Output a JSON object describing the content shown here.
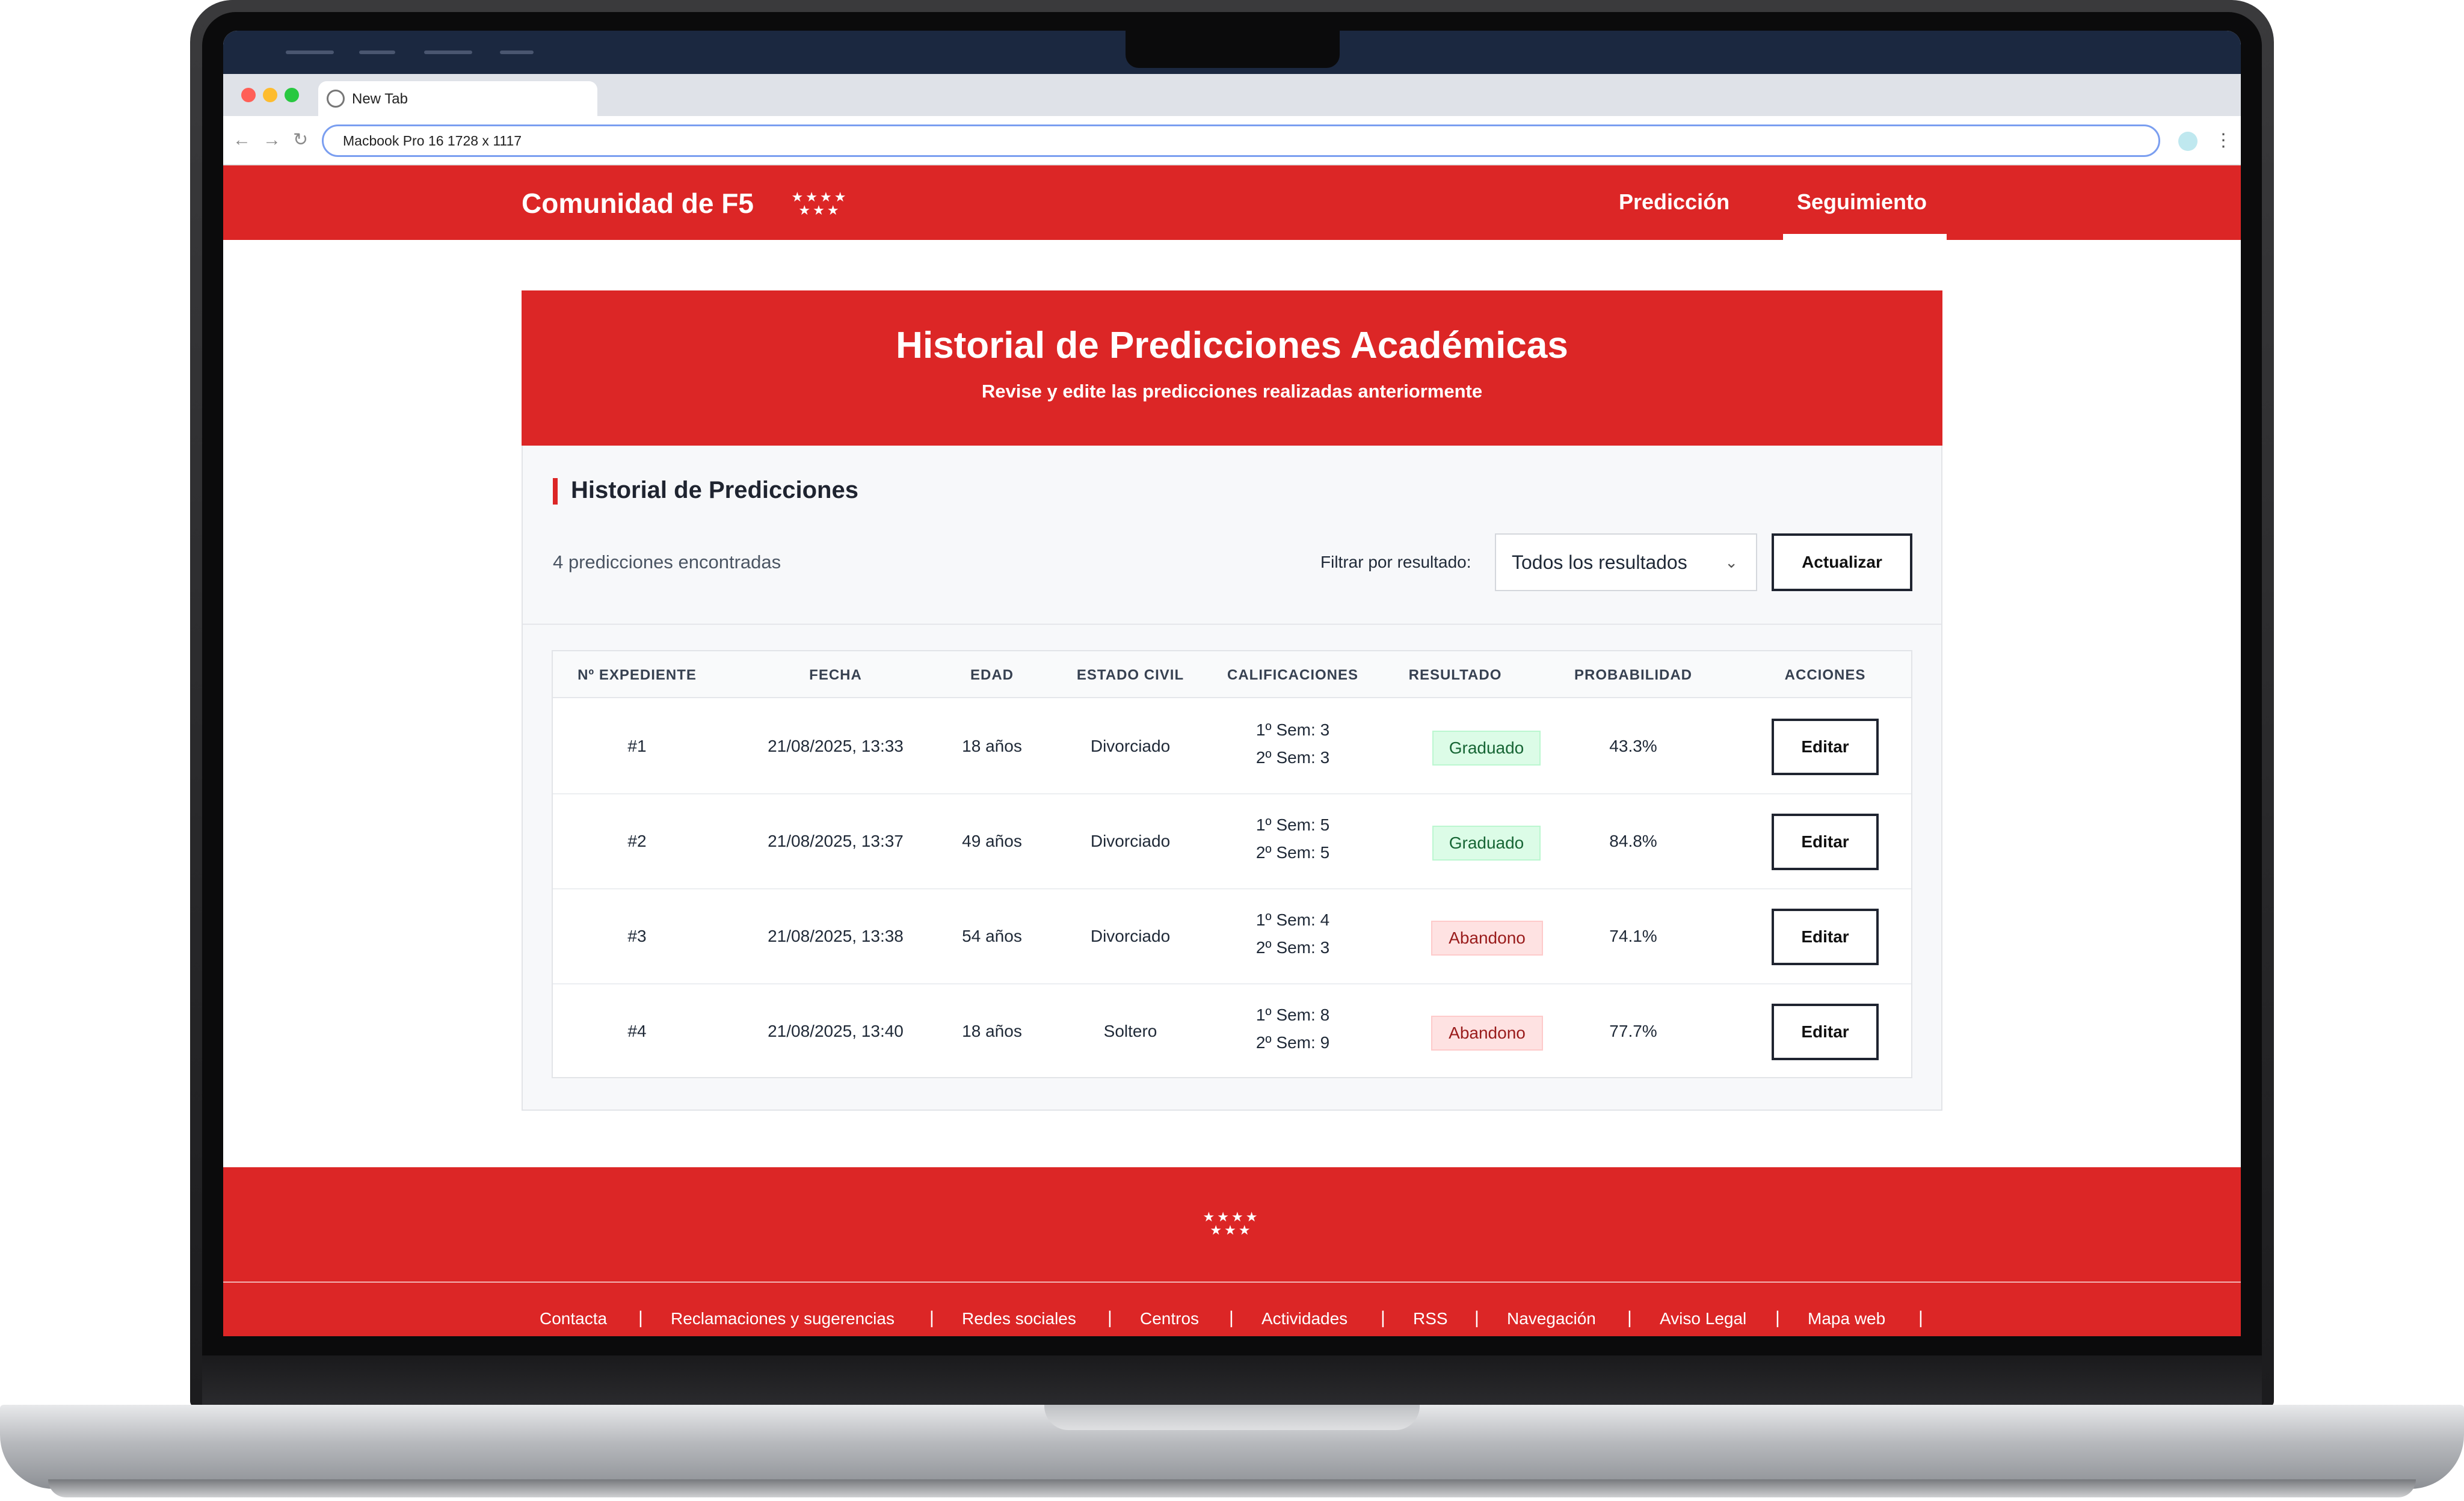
{
  "browser": {
    "tab_title": "New Tab",
    "address": "Macbook Pro 16  1728 x 1117"
  },
  "site": {
    "brand": "Comunidad de F5",
    "nav": [
      {
        "label": "Predicción",
        "active": false
      },
      {
        "label": "Seguimiento",
        "active": true
      }
    ]
  },
  "hero": {
    "title": "Historial de Predicciones Académicas",
    "subtitle": "Revise y edite las predicciones realizadas anteriormente"
  },
  "history": {
    "section_title": "Historial de Predicciones",
    "count_text": "4 predicciones encontradas",
    "filter_label": "Filtrar por resultado:",
    "filter_value": "Todos los resultados",
    "refresh_label": "Actualizar",
    "columns": [
      "Nº EXPEDIENTE",
      "FECHA",
      "EDAD",
      "ESTADO CIVIL",
      "CALIFICACIONES",
      "RESULTADO",
      "PROBABILIDAD",
      "ACCIONES"
    ],
    "rows": [
      {
        "id": "#1",
        "date": "21/08/2025, 13:33",
        "age": "18 años",
        "civil": "Divorciado",
        "sem1": "1º Sem: 3",
        "sem2": "2º Sem: 3",
        "result": "Graduado",
        "result_type": "ok",
        "probability": "43.3%",
        "action": "Editar"
      },
      {
        "id": "#2",
        "date": "21/08/2025, 13:37",
        "age": "49 años",
        "civil": "Divorciado",
        "sem1": "1º Sem: 5",
        "sem2": "2º Sem: 5",
        "result": "Graduado",
        "result_type": "ok",
        "probability": "84.8%",
        "action": "Editar"
      },
      {
        "id": "#3",
        "date": "21/08/2025, 13:38",
        "age": "54 años",
        "civil": "Divorciado",
        "sem1": "1º Sem: 4",
        "sem2": "2º Sem: 3",
        "result": "Abandono",
        "result_type": "bad",
        "probability": "74.1%",
        "action": "Editar"
      },
      {
        "id": "#4",
        "date": "21/08/2025, 13:40",
        "age": "18 años",
        "civil": "Soltero",
        "sem1": "1º Sem: 8",
        "sem2": "2º Sem: 9",
        "result": "Abandono",
        "result_type": "bad",
        "probability": "77.7%",
        "action": "Editar"
      }
    ]
  },
  "footer": {
    "links": [
      "Contacta",
      "Reclamaciones y sugerencias",
      "Redes sociales",
      "Centros",
      "Actividades",
      "RSS",
      "Navegación",
      "Aviso Legal",
      "Mapa web"
    ],
    "separator": "|"
  },
  "colors": {
    "brand_red": "#dc2626",
    "success_bg": "#dcfce7",
    "danger_bg": "#fee2e2"
  },
  "icons": {
    "logo": "stars-icon",
    "dropdown": "chevron-down-icon"
  }
}
